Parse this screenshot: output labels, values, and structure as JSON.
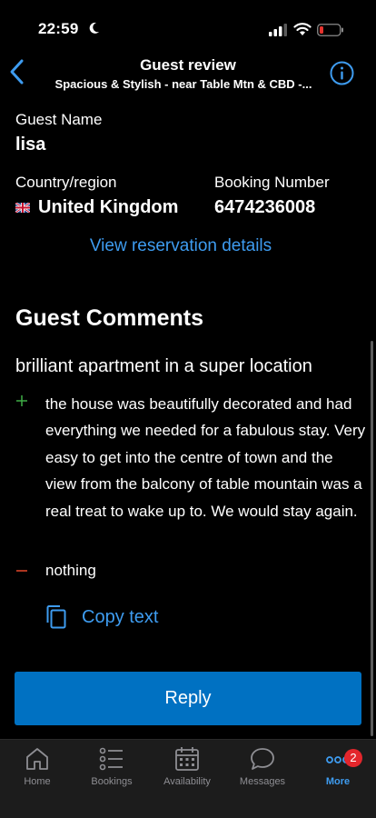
{
  "status_bar": {
    "time": "22:59"
  },
  "header": {
    "title": "Guest review",
    "subtitle": "Spacious & Stylish - near Table Mtn & CBD -..."
  },
  "guest": {
    "name_label": "Guest Name",
    "name": "lisa",
    "country_label": "Country/region",
    "country": "United Kingdom",
    "booking_label": "Booking Number",
    "booking_number": "6474236008",
    "view_details": "View reservation details"
  },
  "comments": {
    "heading": "Guest Comments",
    "title": "brilliant apartment in a super location",
    "positive": "the house was beautifully decorated and had everything we needed for a fabulous stay. Very easy to get into the centre of town and the view from the balcony of table mountain was a real treat to wake up to.  We would stay again.",
    "negative": "nothing",
    "copy_label": "Copy text"
  },
  "reply_label": "Reply",
  "tabs": [
    {
      "label": "Home",
      "icon": "home-icon"
    },
    {
      "label": "Bookings",
      "icon": "list-icon"
    },
    {
      "label": "Availability",
      "icon": "calendar-icon"
    },
    {
      "label": "Messages",
      "icon": "chat-bubble-icon"
    },
    {
      "label": "More",
      "icon": "more-icon",
      "badge": "2"
    }
  ],
  "colors": {
    "accent": "#3e9cf0",
    "button": "#0071c2",
    "positive": "#3fae47",
    "negative": "#e6472b",
    "badge": "#e3262c"
  }
}
